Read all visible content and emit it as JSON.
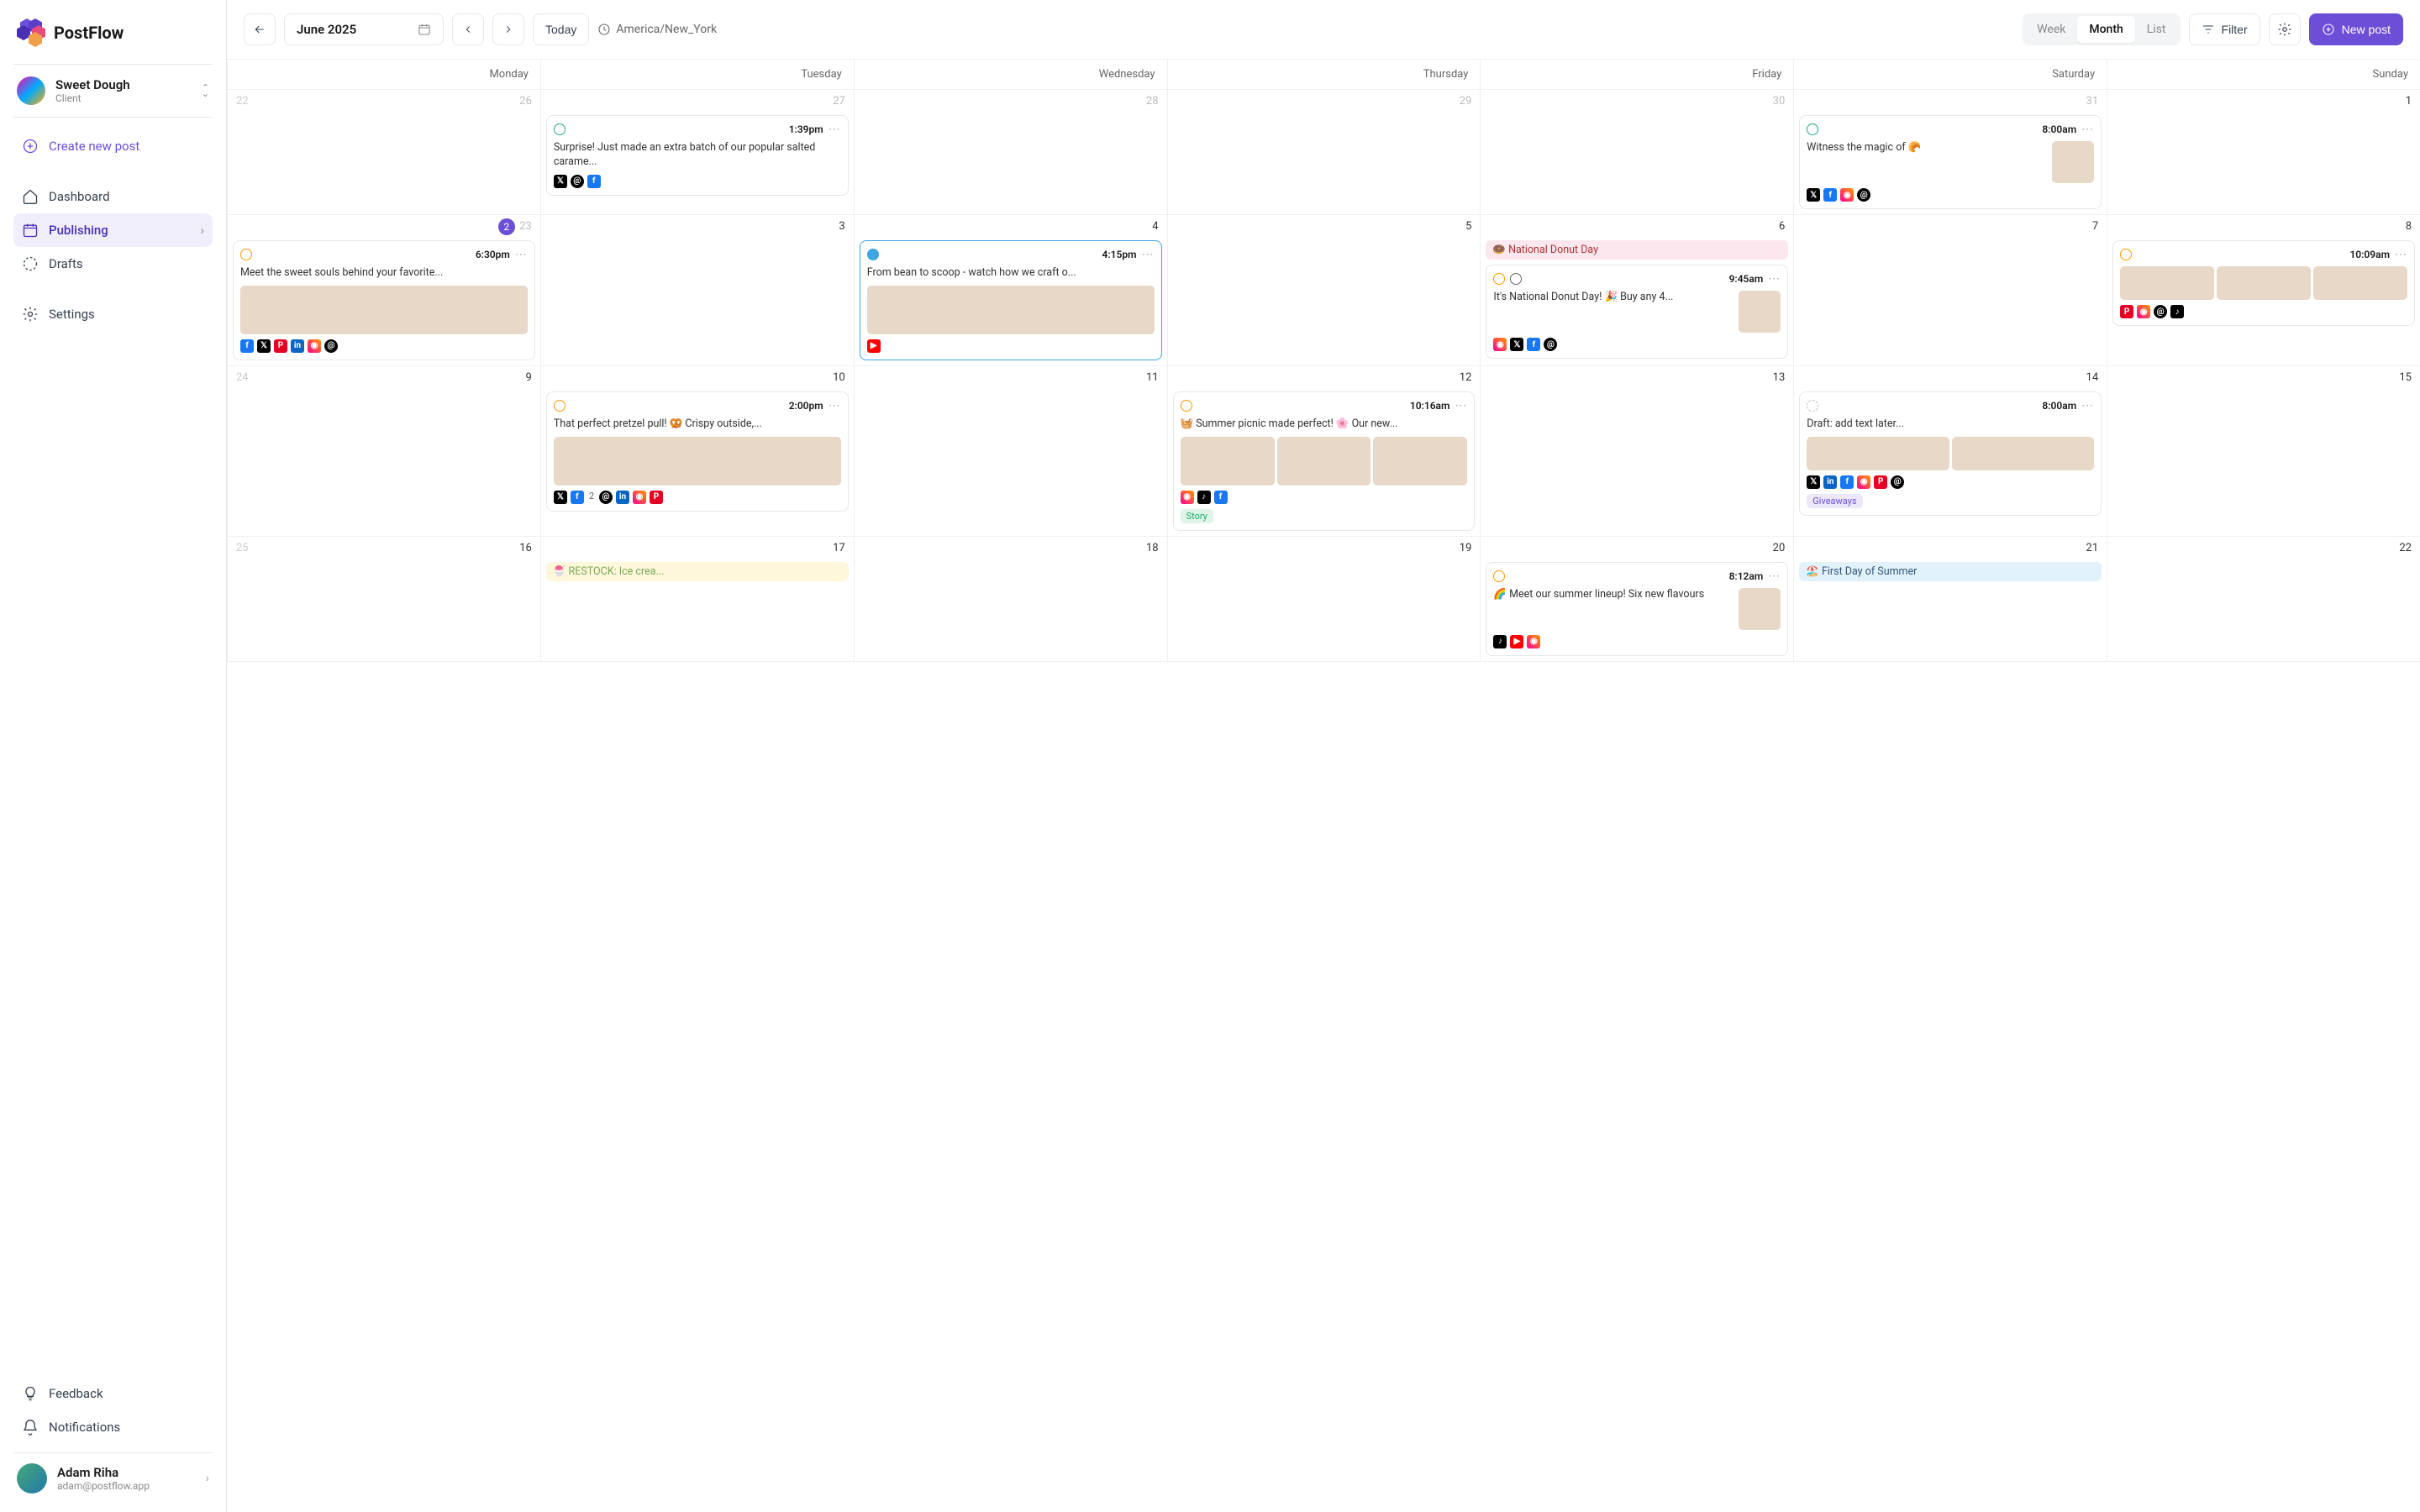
{
  "brand": "PostFlow",
  "client": {
    "name": "Sweet Dough",
    "role": "Client"
  },
  "nav": {
    "create": "Create new post",
    "dashboard": "Dashboard",
    "publishing": "Publishing",
    "drafts": "Drafts",
    "settings": "Settings",
    "feedback": "Feedback",
    "notifications": "Notifications"
  },
  "user": {
    "name": "Adam Riha",
    "email": "adam@postflow.app"
  },
  "toolbar": {
    "month": "June 2025",
    "today": "Today",
    "timezone": "America/New_York",
    "views": {
      "week": "Week",
      "month": "Month",
      "list": "List"
    },
    "filter": "Filter",
    "newpost": "New post"
  },
  "days": [
    "Monday",
    "Tuesday",
    "Wednesday",
    "Thursday",
    "Friday",
    "Saturday",
    "Sunday"
  ],
  "grid": [
    [
      {
        "n": "26",
        "prev": "22"
      },
      {
        "n": "27",
        "post": {
          "status": "ok",
          "time": "1:39pm",
          "text": "Surprise! Just made an extra batch of our popular salted carame...",
          "socials": [
            "tw",
            "th",
            "fb"
          ]
        }
      },
      {
        "n": "28"
      },
      {
        "n": "29"
      },
      {
        "n": "30"
      },
      {
        "n": "31",
        "post": {
          "status": "ok",
          "time": "8:00am",
          "layout": "side",
          "text": "Witness the magic of 🥐",
          "socials": [
            "tw",
            "fb",
            "ig",
            "th"
          ]
        }
      },
      {
        "n": "1",
        "cur": true
      }
    ],
    [
      {
        "n": "23",
        "prev": true,
        "badge": "2",
        "post": {
          "status": "clock",
          "time": "6:30pm",
          "text": "Meet the sweet souls behind your favorite...",
          "imgs": 1,
          "imgh": "lg",
          "socials": [
            "fb",
            "tw",
            "pn",
            "li",
            "ig",
            "th"
          ]
        }
      },
      {
        "n": "3",
        "cur": true
      },
      {
        "n": "4",
        "cur": true,
        "post": {
          "status": "eye",
          "outlined": true,
          "time": "4:15pm",
          "text": "From bean to scoop - watch how we craft o...",
          "imgs": 1,
          "imgh": "lg",
          "socials": [
            "yt"
          ]
        }
      },
      {
        "n": "5",
        "cur": true
      },
      {
        "n": "6",
        "cur": true,
        "pill": {
          "text": "🍩 National Donut Day",
          "cls": "pill-pink"
        },
        "post": {
          "status": "clock",
          "extra": "globe",
          "time": "9:45am",
          "layout": "side",
          "text": "It's National Donut Day! 🎉 Buy any 4...",
          "socials": [
            "ig",
            "tw",
            "fb",
            "th"
          ]
        }
      },
      {
        "n": "7",
        "cur": true
      },
      {
        "n": "8",
        "cur": true,
        "post": {
          "status": "clock",
          "time": "10:09am",
          "imgs": 3,
          "imgh": "xs",
          "socials": [
            "pn",
            "ig",
            "th",
            "tk"
          ]
        }
      }
    ],
    [
      {
        "n": "9",
        "cur": true,
        "prev": "24"
      },
      {
        "n": "10",
        "cur": true,
        "post": {
          "status": "clock",
          "time": "2:00pm",
          "text": "That perfect pretzel pull! 🥨 Crispy outside,...",
          "imgs": 1,
          "imgh": "lg",
          "socials": [
            "tw",
            "fb",
            "_2",
            "th",
            "li",
            "ig",
            "pn"
          ]
        }
      },
      {
        "n": "11",
        "cur": true
      },
      {
        "n": "12",
        "cur": true,
        "post": {
          "status": "clock",
          "time": "10:16am",
          "text": "🧺 Summer picnic made perfect! 🌸 Our new...",
          "imgs": 3,
          "imgh": "lg",
          "socials": [
            "ig",
            "tk",
            "fb"
          ],
          "tag": {
            "text": "Story",
            "cls": "green"
          }
        }
      },
      {
        "n": "13",
        "cur": true
      },
      {
        "n": "14",
        "cur": true,
        "post": {
          "status": "draft",
          "time": "8:00am",
          "text": "Draft: add text later...",
          "imgs": 2,
          "imgh": "xs",
          "socials": [
            "tw",
            "li",
            "fb",
            "ig",
            "pn",
            "th"
          ],
          "tag": {
            "text": "Giveaways",
            "cls": "purple"
          }
        }
      },
      {
        "n": "15",
        "cur": true
      }
    ],
    [
      {
        "n": "16",
        "cur": true,
        "prev": "25"
      },
      {
        "n": "17",
        "cur": true,
        "pill": {
          "text": "🍧 RESTOCK: Ice crea...",
          "cls": "pill-yellow"
        }
      },
      {
        "n": "18",
        "cur": true
      },
      {
        "n": "19",
        "cur": true
      },
      {
        "n": "20",
        "cur": true,
        "post": {
          "status": "clock",
          "time": "8:12am",
          "layout": "side",
          "text": "🌈 Meet our summer lineup! Six new flavours",
          "socials": [
            "tk",
            "yt",
            "ig"
          ]
        }
      },
      {
        "n": "21",
        "cur": true,
        "pill": {
          "text": "🏖️ First Day of Summer",
          "cls": "pill-blue"
        }
      },
      {
        "n": "22",
        "cur": true
      }
    ]
  ]
}
